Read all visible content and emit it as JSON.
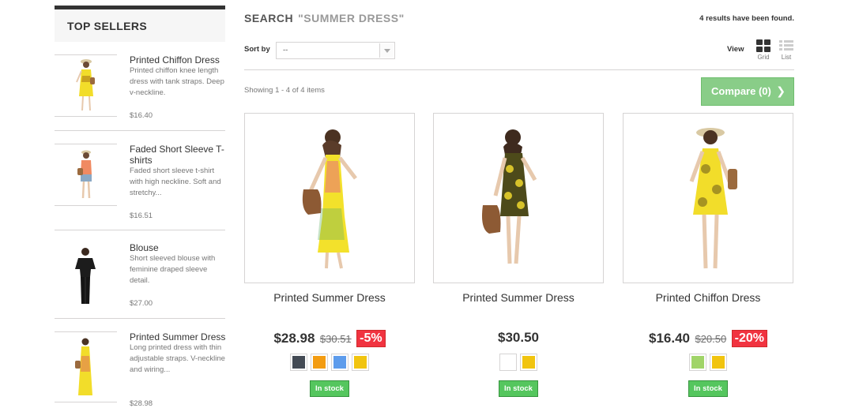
{
  "sidebar": {
    "title": "Top sellers",
    "items": [
      {
        "name": "Printed Chiffon Dress",
        "desc": "Printed chiffon knee length dress with tank straps. Deep v-neckline.",
        "price": "$16.40"
      },
      {
        "name": "Faded Short Sleeve T-shirts",
        "desc": "Faded short sleeve t-shirt with high neckline. Soft and stretchy...",
        "price": "$16.51"
      },
      {
        "name": "Blouse",
        "desc": "Short sleeved blouse with feminine draped sleeve detail.",
        "price": "$27.00"
      },
      {
        "name": "Printed Summer Dress",
        "desc": "Long printed dress with thin adjustable straps. V-neckline and wiring...",
        "price": "$28.98"
      }
    ]
  },
  "search": {
    "label": "Search",
    "query": "\"Summer Dress\"",
    "results_count": "4 results have been found."
  },
  "toolbar": {
    "sort_label": "Sort by",
    "sort_value": "--",
    "view_label": "View",
    "grid_label": "Grid",
    "list_label": "List",
    "showing": "Showing 1 - 4 of 4 items",
    "compare_label": "Compare (0)"
  },
  "products": [
    {
      "name": "Printed Summer Dress",
      "price": "$28.98",
      "old_price": "$30.51",
      "discount": "-5%",
      "stock": "In stock",
      "colors": [
        "#434a54",
        "#f39c11",
        "#5d9cec",
        "#f1c40f"
      ]
    },
    {
      "name": "Printed Summer Dress",
      "price": "$30.50",
      "old_price": "",
      "discount": "",
      "stock": "In stock",
      "colors": [
        "#ffffff",
        "#f1c40f"
      ]
    },
    {
      "name": "Printed Chiffon Dress",
      "price": "$16.40",
      "old_price": "$20.50",
      "discount": "-20%",
      "stock": "In stock",
      "colors": [
        "#a0d468",
        "#f1c40f"
      ]
    }
  ],
  "colors": {
    "accent_green": "#89cd88",
    "stock_green": "#55c65e",
    "discount_red": "#f13340"
  }
}
